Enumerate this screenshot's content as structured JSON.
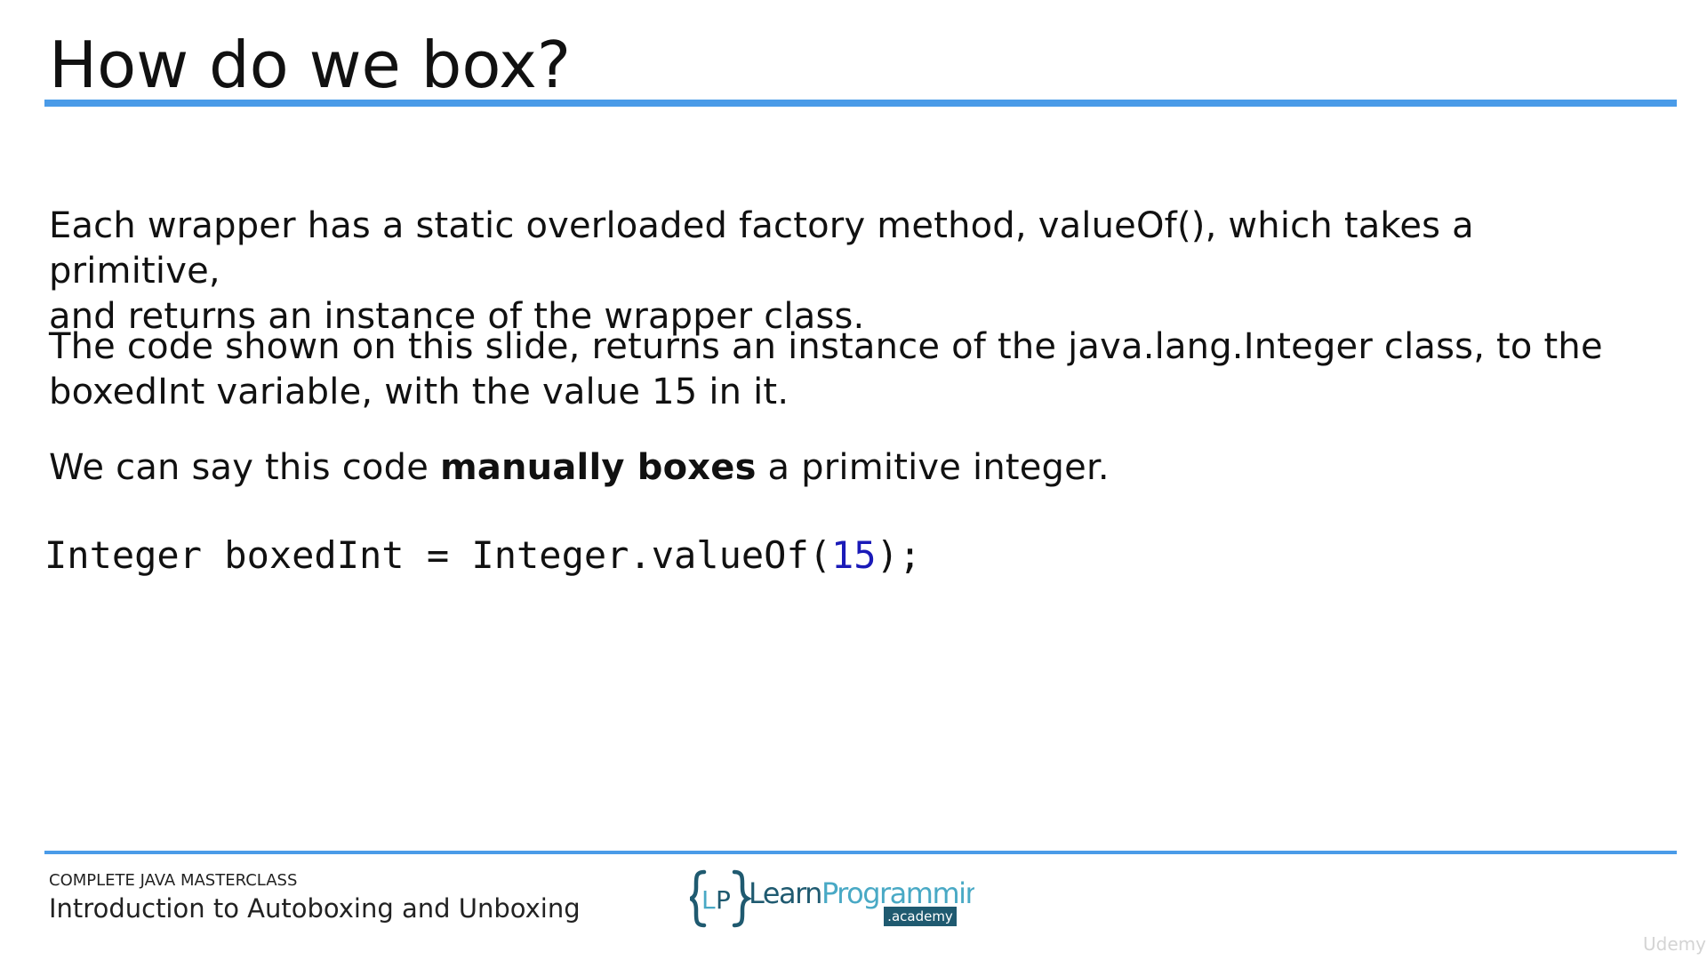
{
  "slide": {
    "title": "How do we box?",
    "paragraphs": {
      "p1": {
        "line1": "Each wrapper has a static overloaded factory method, valueOf(), which takes a primitive,",
        "line2": "and returns an instance of the wrapper class."
      },
      "p2": {
        "line1": "The code shown on this slide, returns an instance of the java.lang.Integer class, to the",
        "line2": "boxedInt variable, with the value 15 in it."
      },
      "p3": {
        "before": "We can say this code ",
        "emphasis": "manually boxes",
        "after": " a primitive integer."
      }
    },
    "code": {
      "before": "Integer boxedInt = Integer.valueOf(",
      "number": "15",
      "after": ");"
    }
  },
  "footer": {
    "course": "COMPLETE JAVA MASTERCLASS",
    "lecture": "Introduction to Autoboxing and Unboxing",
    "logo_text": "{LP} LearnProgramming .academy"
  },
  "watermark": "Udemy",
  "colors": {
    "rule": "#4a9be8",
    "code_number": "#1a1ab8",
    "logo_dark": "#1f5a70",
    "logo_light": "#49a9c5"
  }
}
